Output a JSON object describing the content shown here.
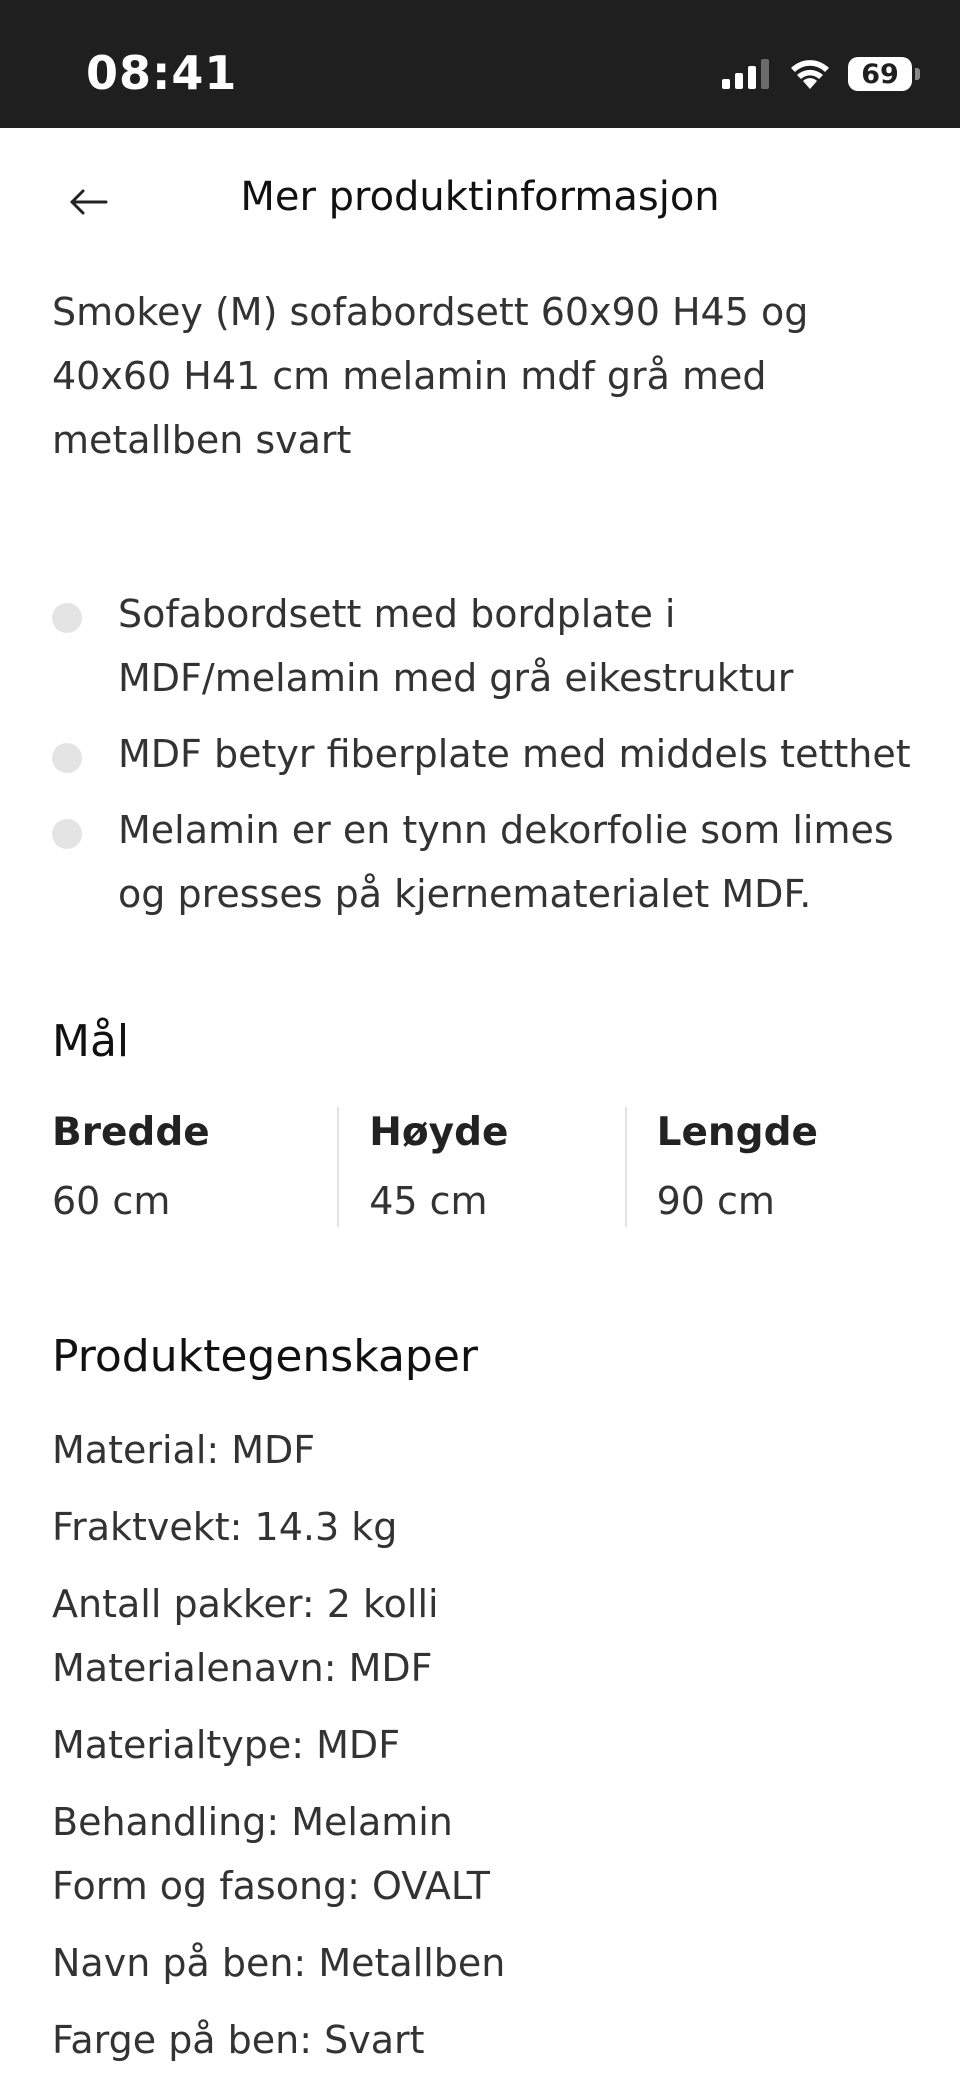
{
  "status_bar": {
    "time": "08:41",
    "battery": "69",
    "icons": [
      "signal-icon",
      "wifi-icon",
      "battery-icon"
    ]
  },
  "header": {
    "back_icon": "arrow-left-icon",
    "title": "Mer produktinformasjon"
  },
  "product": {
    "name": "Smokey (M) sofabordsett 60x90 H45 og 40x60 H41 cm melamin mdf grå med metallben svart",
    "bullets": [
      "Sofabordsett med bordplate i MDF/melamin med grå eikestruktur",
      "MDF betyr fiberplate med middels tetthet",
      "Melamin er en tynn dekorfolie som limes og presses på kjernematerialet MDF."
    ]
  },
  "dimensions": {
    "heading": "Mål",
    "items": [
      {
        "label": "Bredde",
        "value": "60 cm"
      },
      {
        "label": "Høyde",
        "value": "45 cm"
      },
      {
        "label": "Lengde",
        "value": "90 cm"
      }
    ]
  },
  "properties": {
    "heading": "Produktegenskaper",
    "items": [
      "Material: MDF",
      "Fraktvekt: 14.3 kg",
      "Antall pakker: 2 kolli",
      "Materialenavn: MDF",
      "Materialtype: MDF",
      "Behandling: Melamin",
      "Form og fasong: OVALT",
      "Navn på ben: Metallben",
      "Farge på ben: Svart"
    ]
  },
  "colors": {
    "status_bar_bg": "#1f1f1f",
    "bullet_dot": "#e4e4e4",
    "divider": "#e2e2e2"
  }
}
